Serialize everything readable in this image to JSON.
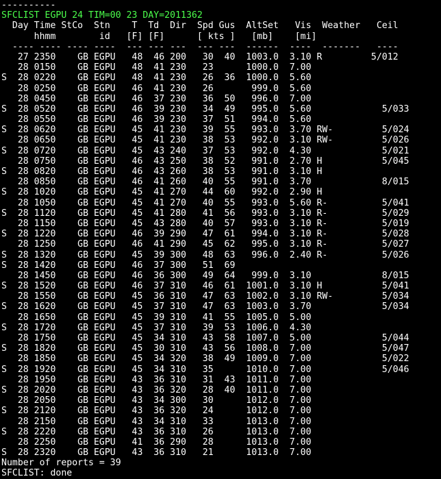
{
  "lines": [
    {
      "text": "----------",
      "color": "white"
    },
    {
      "text": "SFCLIST EGPU 24 TIM=00 23 DAY=2011362",
      "color": "green"
    },
    {
      "text": "  Day Time StCo  Stn    T  Td  Dir  Spd Gus  AltSet   Vis  Weather   Ceil",
      "color": "white"
    },
    {
      "text": "      hhmm        id   [F] [F]      [ kts ]   [mb]    [mi]",
      "color": "white"
    },
    {
      "text": "  ---- ---- ---- ----  --- --- ---  --- ---  ------  ----  -------   ----",
      "color": "white"
    },
    {
      "text": "   27 2350    GB EGPU   48  46 200   30  40  1003.0  3.10 R         5/012",
      "color": "white"
    },
    {
      "text": "   28 0150    GB EGPU   48  41 230   23      1000.0  7.00",
      "color": "white"
    },
    {
      "text": "S  28 0220    GB EGPU   48  41 230   26  36  1000.0  5.60",
      "color": "white"
    },
    {
      "text": "   28 0250    GB EGPU   46  41 230   26       999.0  5.60",
      "color": "white"
    },
    {
      "text": "   28 0450    GB EGPU   46  37 230   36  50   996.0  7.00",
      "color": "white"
    },
    {
      "text": "S  28 0520    GB EGPU   46  39 230   34  49   995.0  5.60             5/033",
      "color": "white"
    },
    {
      "text": "   28 0550    GB EGPU   46  39 230   37  51   994.0  5.60",
      "color": "white"
    },
    {
      "text": "S  28 0620    GB EGPU   45  41 230   39  55   993.0  3.70 RW-         5/024",
      "color": "white"
    },
    {
      "text": "   28 0650    GB EGPU   45  41 230   38  53   992.0  3.10 RW-         5/026",
      "color": "white"
    },
    {
      "text": "S  28 0720    GB EGPU   45  43 240   37  53   992.0  4.30             5/021",
      "color": "white"
    },
    {
      "text": "   28 0750    GB EGPU   46  43 250   38  52   991.0  2.70 H           5/045",
      "color": "white"
    },
    {
      "text": "S  28 0820    GB EGPU   46  43 260   38  53   991.0  3.10 H",
      "color": "white"
    },
    {
      "text": "   28 0850    GB EGPU   46  41 260   40  55   991.0  3.70             8/015",
      "color": "white"
    },
    {
      "text": "S  28 1020    GB EGPU   45  41 270   44  60   992.0  2.90 H",
      "color": "white"
    },
    {
      "text": "   28 1050    GB EGPU   45  41 270   40  55   993.0  5.60 R-          5/041",
      "color": "white"
    },
    {
      "text": "S  28 1120    GB EGPU   45  41 280   41  56   993.0  3.10 R-          5/029",
      "color": "white"
    },
    {
      "text": "   28 1150    GB EGPU   45  43 280   40  57   993.0  3.10 R-          5/019",
      "color": "white"
    },
    {
      "text": "S  28 1220    GB EGPU   46  39 290   47  61   994.0  3.10 R-          5/028",
      "color": "white"
    },
    {
      "text": "   28 1250    GB EGPU   46  41 290   45  62   995.0  3.10 R-          5/027",
      "color": "white"
    },
    {
      "text": "S  28 1320    GB EGPU   45  39 300   48  63   996.0  2.40 R-          5/026",
      "color": "white"
    },
    {
      "text": "S  28 1420    GB EGPU   46  37 300   51  69",
      "color": "white"
    },
    {
      "text": "   28 1450    GB EGPU   46  36 300   49  64   999.0  3.10             8/015",
      "color": "white"
    },
    {
      "text": "S  28 1520    GB EGPU   46  37 310   46  61  1001.0  3.10 H           5/041",
      "color": "white"
    },
    {
      "text": "   28 1550    GB EGPU   45  36 310   47  63  1002.0  3.10 RW-         5/034",
      "color": "white"
    },
    {
      "text": "S  28 1620    GB EGPU   45  37 310   47  63  1003.0  3.70             5/034",
      "color": "white"
    },
    {
      "text": "   28 1650    GB EGPU   45  39 310   41  55  1005.0  5.00",
      "color": "white"
    },
    {
      "text": "S  28 1720    GB EGPU   45  37 310   39  53  1006.0  4.30",
      "color": "white"
    },
    {
      "text": "   28 1750    GB EGPU   45  34 310   43  58  1007.0  5.00             5/044",
      "color": "white"
    },
    {
      "text": "S  28 1820    GB EGPU   45  30 310   43  56  1008.0  7.00             5/047",
      "color": "white"
    },
    {
      "text": "   28 1850    GB EGPU   45  34 320   38  49  1009.0  7.00             5/022",
      "color": "white"
    },
    {
      "text": "S  28 1920    GB EGPU   45  34 310   35      1010.0  7.00             5/046",
      "color": "white"
    },
    {
      "text": "   28 1950    GB EGPU   43  36 310   31  43  1011.0  7.00",
      "color": "white"
    },
    {
      "text": "S  28 2020    GB EGPU   43  36 320   28  40  1011.0  7.00",
      "color": "white"
    },
    {
      "text": "   28 2050    GB EGPU   43  34 300   30      1012.0  7.00",
      "color": "white"
    },
    {
      "text": "S  28 2120    GB EGPU   43  36 320   24      1012.0  7.00",
      "color": "white"
    },
    {
      "text": "   28 2150    GB EGPU   43  34 310   33      1013.0  7.00",
      "color": "white"
    },
    {
      "text": "S  28 2220    GB EGPU   43  36 310   26      1013.0  7.00",
      "color": "white"
    },
    {
      "text": "   28 2250    GB EGPU   41  36 290   28      1013.0  7.00",
      "color": "white"
    },
    {
      "text": "S  28 2320    GB EGPU   43  36 310   21      1013.0  7.00",
      "color": "white"
    },
    {
      "text": "Number of reports = 39",
      "color": "white"
    },
    {
      "text": "SFCLIST: done",
      "color": "white"
    }
  ]
}
